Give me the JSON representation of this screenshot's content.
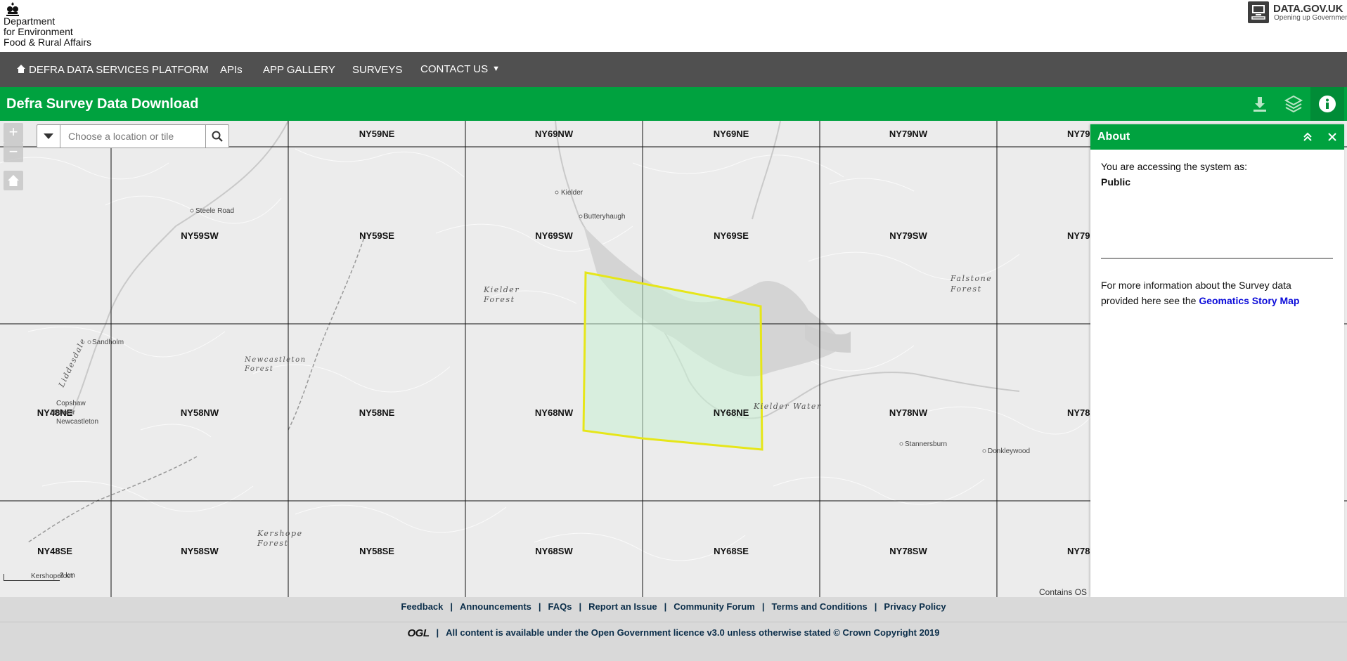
{
  "brand": {
    "department_lines": [
      "Department",
      "for Environment",
      "Food & Rural Affairs"
    ],
    "crest_icon": "royal-crest-icon",
    "datagov_title": "DATA.GOV.UK",
    "datagov_subtitle": "Opening up Government"
  },
  "nav": {
    "items": [
      {
        "label": "DEFRA DATA SERVICES PLATFORM",
        "icon": "home-icon"
      },
      {
        "label": "APIs"
      },
      {
        "label": "APP GALLERY"
      },
      {
        "label": "SURVEYS"
      },
      {
        "label": "CONTACT US",
        "has_dropdown": true
      }
    ]
  },
  "app_header": {
    "title": "Defra Survey Data Download",
    "buttons": [
      {
        "name": "download",
        "icon": "download-icon"
      },
      {
        "name": "layers",
        "icon": "layers-icon"
      },
      {
        "name": "info",
        "icon": "info-icon",
        "active": true
      }
    ]
  },
  "map": {
    "search": {
      "placeholder": "Choose a location or tile",
      "value": ""
    },
    "zoom_in": "+",
    "zoom_out": "−",
    "scale_label": "2 km",
    "attribution": "Contains OS",
    "tile_labels": [
      "NY59NE",
      "NY69NW",
      "NY69NE",
      "NY79NW",
      "NY79",
      "NY59SW",
      "NY59SE",
      "NY69SW",
      "NY69SE",
      "NY79SW",
      "NY79",
      "NY48NE",
      "NY58NW",
      "NY58NE",
      "NY68NW",
      "NY68NE",
      "NY78NW",
      "NY78",
      "NY48SE",
      "NY58SW",
      "NY58SE",
      "NY68SW",
      "NY68SE",
      "NY78SW",
      "NY78"
    ],
    "place_labels": [
      "Kielder",
      "Butteryhaugh",
      "Steele Road",
      "Sandholm",
      "Copshaw",
      "Holm or",
      "Newcastleton",
      "Stannersburn",
      "Donkleywood",
      "Kershopefoot",
      "Liddesdale",
      "Newcastleton",
      "Forest"
    ],
    "forest_labels": [
      "Kielder",
      "Forest",
      "Falstone",
      "Forest",
      "Kielder Water",
      "Kershope",
      "Forest"
    ],
    "selection_color": "#e6e619",
    "selection_fill": "#c8f0d4"
  },
  "about": {
    "title": "About",
    "access_text": "You are accessing the system as:",
    "role": "Public",
    "more_text": "For more information about the Survey data provided here see the",
    "link_text": "Geomatics Story Map"
  },
  "footer": {
    "links": [
      "Feedback",
      "Announcements",
      "FAQs",
      "Report an Issue",
      "Community Forum",
      "Terms and Conditions",
      "Privacy Policy"
    ],
    "ogl_mark": "OGL",
    "licence_text": "All content is available under the Open Government licence v3.0 unless otherwise stated © Crown Copyright 2019"
  }
}
